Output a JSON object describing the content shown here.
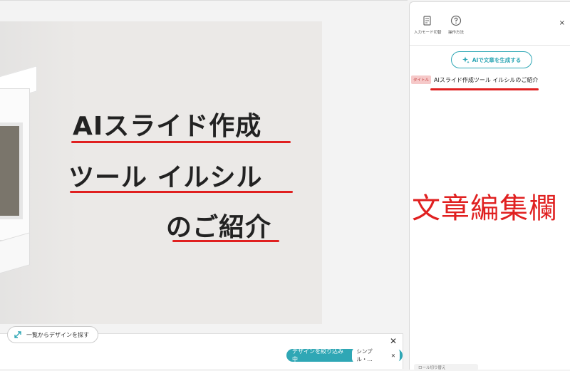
{
  "slide": {
    "line1": "AIスライド作成",
    "line2": "ツール イルシル",
    "line3": "のご紹介",
    "underline_color": "#e02020"
  },
  "bottom_bar": {
    "browse_label": "一覧からデザインを探す",
    "filter_label": "デザインを絞り込み中",
    "filter_value": "シンプル・…",
    "filter_close": "✕",
    "close_icon": "✕"
  },
  "side_panel": {
    "tool1_label": "入力モード切替",
    "tool2_label": "操作方法",
    "close_icon": "×",
    "gen_button_label": "AIで文章を生成する",
    "title_badge": "タイトル",
    "title_text": "AIスライド作成ツール イルシルのご紹介",
    "annotation": "文章編集欄",
    "bottom_hint": "ロール切り替え"
  },
  "colors": {
    "accent": "#2fa7b5",
    "annotation": "#e02020"
  }
}
